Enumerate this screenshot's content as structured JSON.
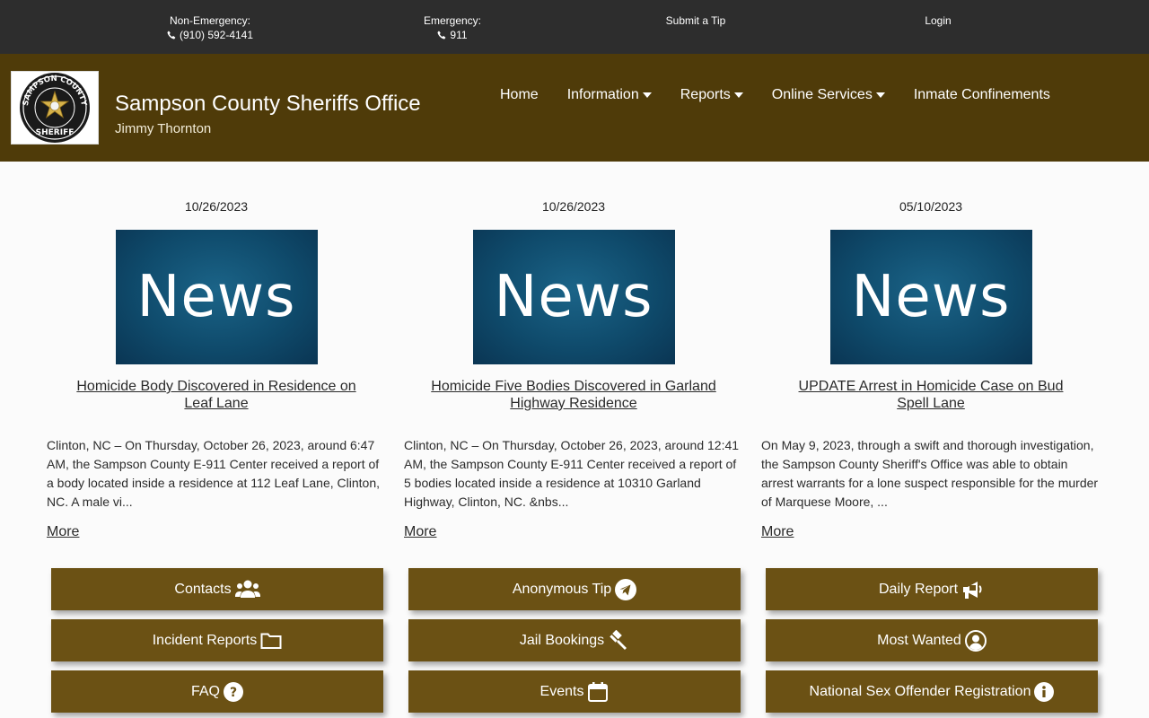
{
  "topbar": {
    "non_emergency_label": "Non-Emergency:",
    "non_emergency_phone": "(910) 592-4141",
    "emergency_label": "Emergency:",
    "emergency_phone": "911",
    "tip": "Submit a Tip",
    "login": "Login"
  },
  "header": {
    "title": "Sampson County Sheriffs Office",
    "subtitle": "Jimmy Thornton",
    "logo_text_top": "SAMPSON COUNTY",
    "logo_text_bottom": "SHERIFF",
    "nav": [
      {
        "label": "Home"
      },
      {
        "label": "Information"
      },
      {
        "label": "Reports"
      },
      {
        "label": "Online Services"
      },
      {
        "label": "Inmate Confinements"
      }
    ]
  },
  "news": [
    {
      "date": "10/26/2023",
      "image_text": "News",
      "title": "Homicide Body Discovered in Residence on Leaf Lane",
      "excerpt": "Clinton, NC – On Thursday, October 26, 2023, around 6:47 AM, the Sampson County E-911 Center received a report of a body located inside a residence at 112 Leaf Lane, Clinton, NC.  A male vi...",
      "more": "More"
    },
    {
      "date": "10/26/2023",
      "image_text": "News",
      "title": "Homicide Five Bodies Discovered in Garland Highway Residence",
      "excerpt": "Clinton, NC – On Thursday, October 26, 2023, around 12:41 AM, the Sampson County E-911 Center received a report of 5 bodies located inside a residence at 10310 Garland Highway, Clinton, NC. &nbs...",
      "more": "More"
    },
    {
      "date": "05/10/2023",
      "image_text": "News",
      "title": "UPDATE Arrest in Homicide Case on Bud Spell Lane",
      "excerpt": "On May 9, 2023, through a swift and thorough investigation, the Sampson County Sheriff's Office was able to obtain arrest warrants for a lone suspect responsible for the murder of Marquese Moore, ...",
      "more": "More"
    }
  ],
  "buttons": [
    {
      "label": "Contacts",
      "icon": "users-icon"
    },
    {
      "label": "Anonymous Tip",
      "icon": "paper-plane-icon"
    },
    {
      "label": "Daily Report",
      "icon": "megaphone-icon"
    },
    {
      "label": "Incident Reports",
      "icon": "folder-icon"
    },
    {
      "label": "Jail Bookings",
      "icon": "gavel-icon"
    },
    {
      "label": "Most Wanted",
      "icon": "user-circle-icon"
    },
    {
      "label": "FAQ",
      "icon": "question-circle-icon"
    },
    {
      "label": "Events",
      "icon": "calendar-icon"
    },
    {
      "label": "National Sex Offender Registration",
      "icon": "info-circle-icon"
    }
  ],
  "colors": {
    "topbar": "#2d2d2d",
    "header": "#4f3b09",
    "button": "#6b5114",
    "news_image": "#0f4b6c"
  }
}
